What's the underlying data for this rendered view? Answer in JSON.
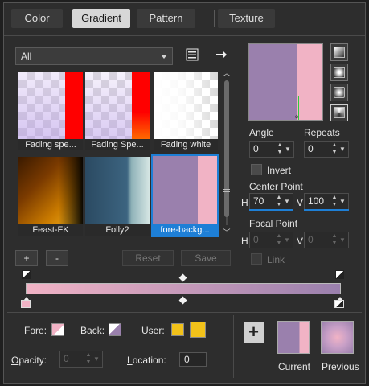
{
  "tabs": [
    {
      "label": "Color",
      "active": false
    },
    {
      "label": "Gradient",
      "active": true
    },
    {
      "label": "Pattern",
      "active": false
    },
    {
      "label": "Texture",
      "active": false
    }
  ],
  "category": {
    "selected": "All"
  },
  "thumbnails": [
    {
      "caption": "Fading spe...",
      "selected": false
    },
    {
      "caption": "Fading Spe...",
      "selected": false
    },
    {
      "caption": "Fading white",
      "selected": false
    },
    {
      "caption": "Feast-FK",
      "selected": false
    },
    {
      "caption": "Folly2",
      "selected": false
    },
    {
      "caption": "fore-backg...",
      "selected": true
    }
  ],
  "list_buttons": {
    "add": "+",
    "remove": "-",
    "reset": "Reset",
    "save": "Save"
  },
  "angle": {
    "label": "Angle",
    "value": "0"
  },
  "repeats": {
    "label": "Repeats",
    "value": "0"
  },
  "invert": {
    "label": "Invert",
    "checked": false
  },
  "center_point": {
    "label": "Center Point",
    "h_label": "H",
    "h_value": "70",
    "v_label": "V",
    "v_value": "100"
  },
  "focal_point": {
    "label": "Focal Point",
    "h_label": "H",
    "h_value": "0",
    "v_label": "V",
    "v_value": "0",
    "enabled": false
  },
  "link": {
    "label": "Link",
    "checked": false
  },
  "fore": {
    "label": "Fore:",
    "underline": "F",
    "rest": "ore:"
  },
  "back": {
    "label": "Back:",
    "underline": "B",
    "rest": "ack:"
  },
  "user": {
    "label": "User:"
  },
  "opacity": {
    "label": "Opacity:",
    "underline": "O",
    "rest": "pacity:",
    "value": "0"
  },
  "location": {
    "label": "Location:",
    "underline": "L",
    "rest": "ocation:",
    "value": "0"
  },
  "current": {
    "label": "Current"
  },
  "previous": {
    "label": "Previous"
  },
  "colors": {
    "purple": "#9a80ad",
    "pink": "#f1b3c5",
    "gold": "#f2c21a",
    "accent": "#1e7fd6"
  }
}
